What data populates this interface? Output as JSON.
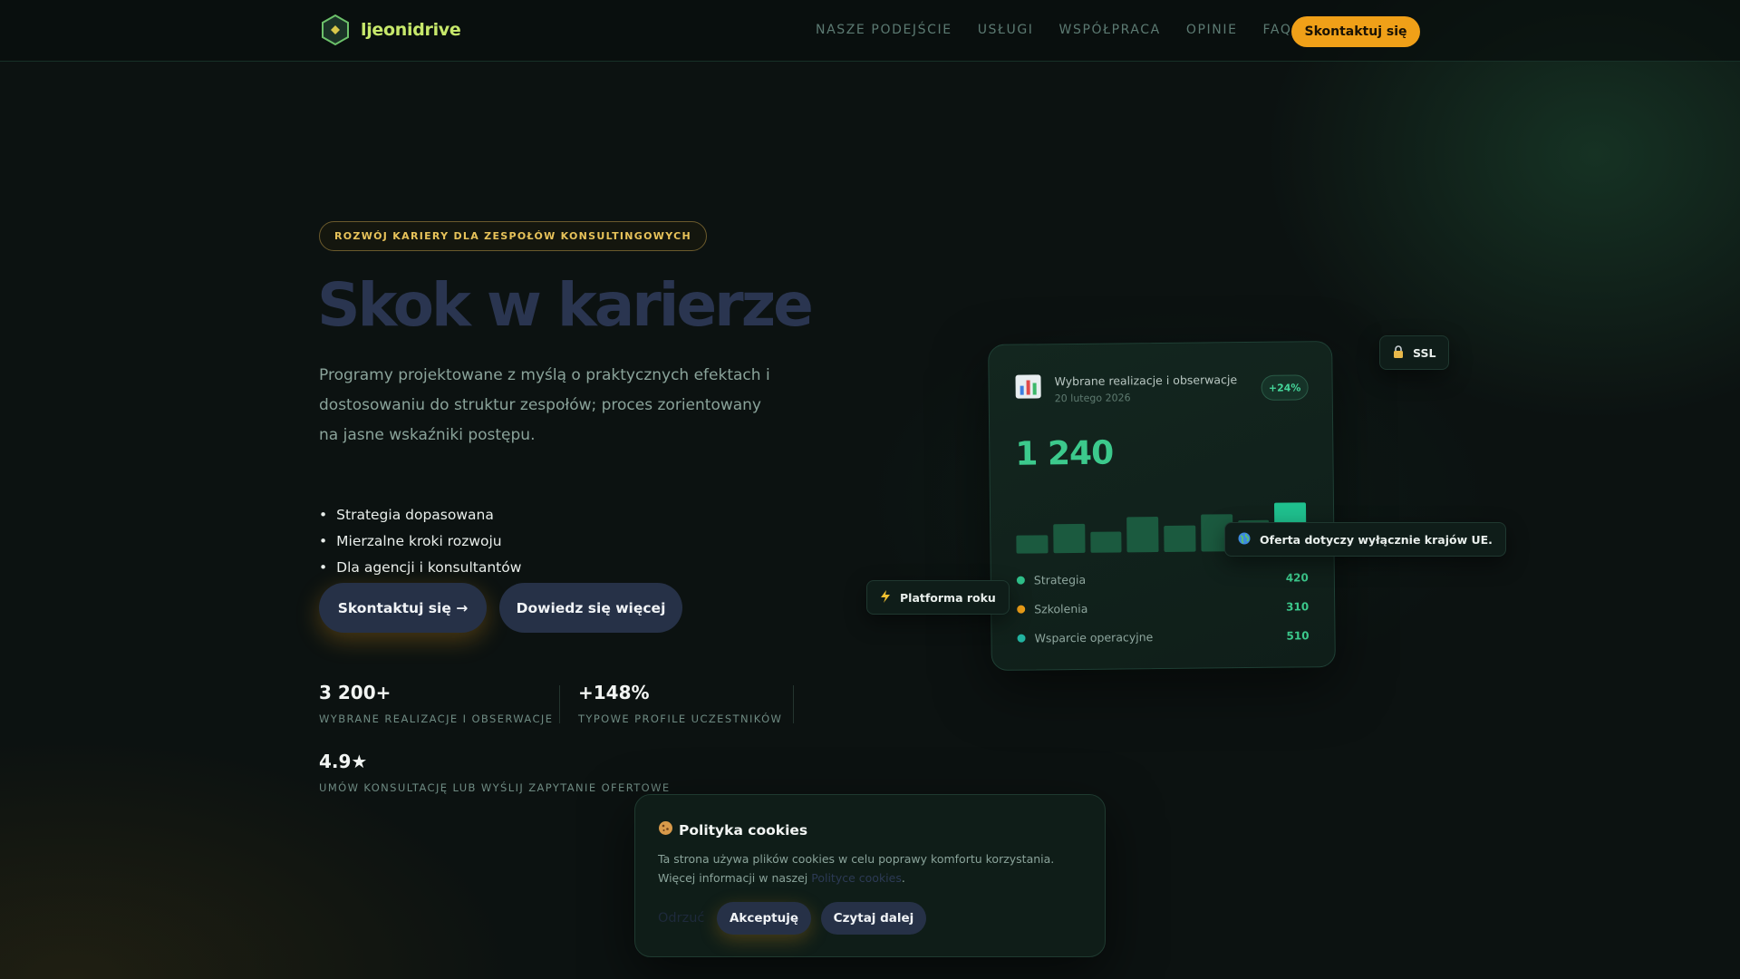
{
  "header": {
    "logo_text": "ljeonidrive",
    "nav": [
      "NASZE PODEJŚCIE",
      "USŁUGI",
      "WSPÓŁPRACA",
      "OPINIE",
      "FAQ"
    ],
    "cta_label": "Skontaktuj się"
  },
  "hero": {
    "badge": "ROZWÓJ KARIERY DLA ZESPOŁÓW KONSULTINGOWYCH",
    "title": "Skok w karierze",
    "description": "Programy projektowane z myślą o praktycznych efektach i dostosowaniu do struktur zespołów; proces zorientowany na jasne wskaźniki postępu.",
    "bullets": [
      "Strategia dopasowana",
      "Mierzalne kroki rozwoju",
      "Dla agencji i konsultantów"
    ],
    "primary_button": "Skontaktuj się →",
    "secondary_button": "Dowiedz się więcej"
  },
  "stats": [
    {
      "value": "3 200+",
      "label": "WYBRANE REALIZACJE I OBSERWACJE"
    },
    {
      "value": "+148%",
      "label": "TYPOWE PROFILE UCZESTNIKÓW"
    },
    {
      "value": "4.9★",
      "label": "UMÓW KONSULTACJĘ LUB WYŚLIJ ZAPYTANIE OFERTOWE"
    }
  ],
  "dashboard": {
    "icon": "bar-chart-icon",
    "title": "Wybrane realizacje i obserwacje",
    "date": "20 lutego 2026",
    "delta": "+24%",
    "big_number": "1 240",
    "bars": [
      0.28,
      0.45,
      0.33,
      0.55,
      0.42,
      0.58,
      0.48,
      0.75
    ],
    "legend": [
      {
        "name": "Strategia",
        "value": "420",
        "color": "#2fc08a"
      },
      {
        "name": "Szkolenia",
        "value": "310",
        "color": "#f0a018"
      },
      {
        "name": "Wsparcie operacyjne",
        "value": "510",
        "color": "#22b3a0"
      }
    ]
  },
  "chips": {
    "ssl": {
      "icon": "lock-icon",
      "label": "SSL"
    },
    "eu": {
      "icon": "globe-icon",
      "label": "Oferta dotyczy wyłącznie krajów UE."
    },
    "platform": {
      "icon": "lightning-icon",
      "label": "Platforma roku"
    }
  },
  "cookie": {
    "icon": "cookie-icon",
    "title": "Polityka cookies",
    "text": "Ta strona używa plików cookies w celu poprawy komfortu korzystania. Więcej informacji w naszej ",
    "link": "Polityce cookies",
    "text_end": ".",
    "reject": "Odrzuć",
    "accept": "Akceptuję",
    "more": "Czytaj dalej"
  },
  "colors": {
    "accent": "#f0a018",
    "green": "#3cc98c",
    "button": "#263147"
  }
}
